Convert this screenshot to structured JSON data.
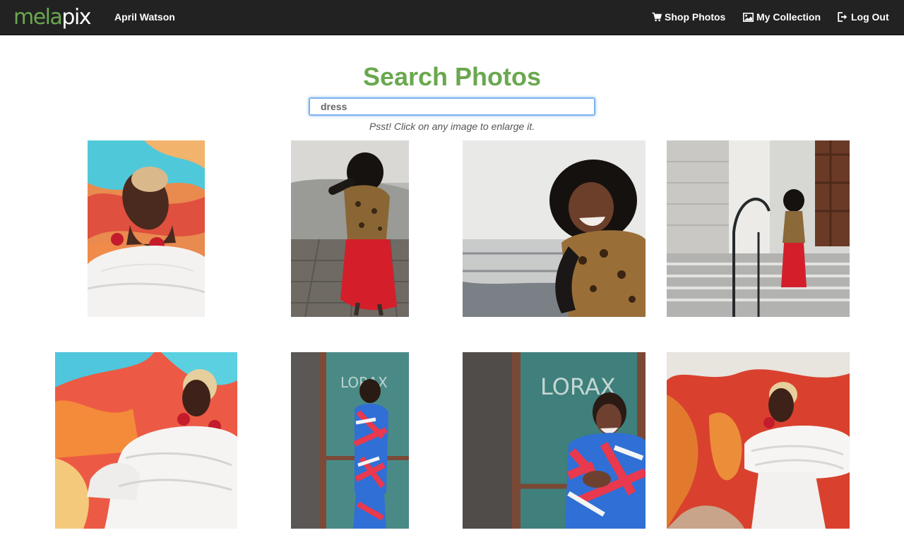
{
  "navbar": {
    "logo_part1": "mela",
    "logo_part2": "pix",
    "username": "April Watson",
    "links": [
      {
        "label": "Shop Photos",
        "icon": "cart-icon"
      },
      {
        "label": "My Collection",
        "icon": "picture-icon"
      },
      {
        "label": "Log Out",
        "icon": "log-out-icon"
      }
    ]
  },
  "search": {
    "title": "Search Photos",
    "query": "dress",
    "hint": "Psst! Click on any image to enlarge it."
  },
  "photos": [
    {
      "subject": "woman-white-dress-red-earrings-mural"
    },
    {
      "subject": "girl-leopard-vest-red-skirt-twirling"
    },
    {
      "subject": "girl-leopard-vest-smiling"
    },
    {
      "subject": "girl-on-stone-steps-railing"
    },
    {
      "subject": "woman-white-ruffle-dress-mural"
    },
    {
      "subject": "woman-geometric-print-dress-teal-door"
    },
    {
      "subject": "woman-geometric-print-dress-laughing"
    },
    {
      "subject": "woman-white-dress-red-mural"
    }
  ],
  "colors": {
    "navbar_bg": "#222222",
    "brand_green": "#6aa84f",
    "focus_blue": "#66afe9"
  }
}
